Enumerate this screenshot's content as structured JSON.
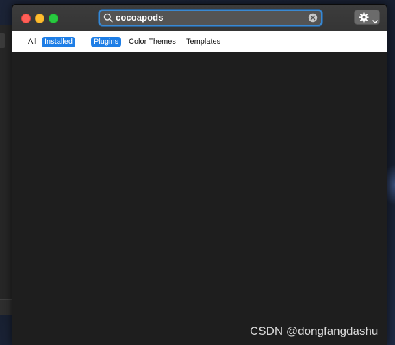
{
  "colors": {
    "close": "#ff5f57",
    "minimize": "#febc2e",
    "zoom": "#28c840",
    "accent": "#1e7ee6",
    "search_border": "#3a89d2"
  },
  "search": {
    "value": "cocoapods",
    "icon": "search-icon",
    "clear_icon": "clear-icon"
  },
  "toolbar": {
    "settings_icon": "gear-icon",
    "dropdown_icon": "chevron-down-icon"
  },
  "filters": {
    "scope": [
      {
        "label": "All",
        "selected": false
      },
      {
        "label": "Installed",
        "selected": true
      }
    ],
    "type": [
      {
        "label": "Plugins",
        "selected": true
      },
      {
        "label": "Color Themes",
        "selected": false
      },
      {
        "label": "Templates",
        "selected": false
      }
    ]
  },
  "watermark": "CSDN @dongfangdashu"
}
